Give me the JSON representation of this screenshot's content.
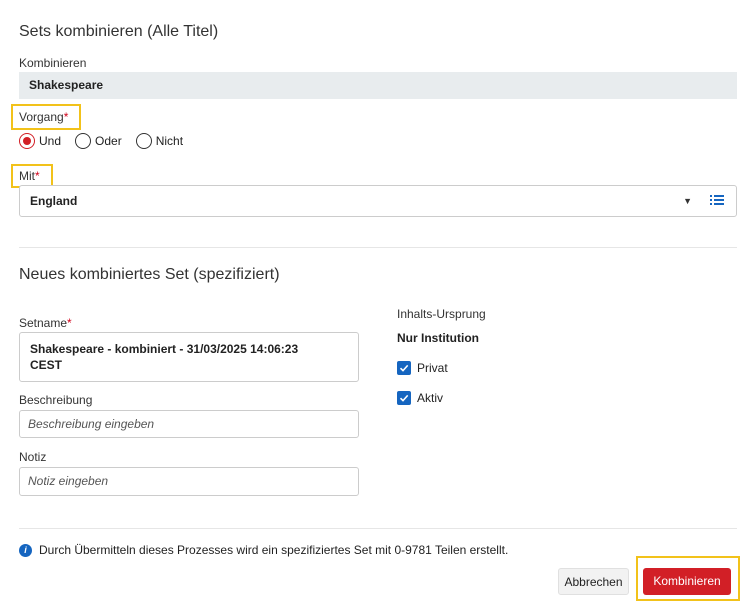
{
  "combine_section": {
    "title": "Sets kombinieren (Alle Titel)",
    "combine_label": "Kombinieren",
    "combine_value": "Shakespeare",
    "operation_label": "Vorgang",
    "required_mark": "*",
    "operations": [
      {
        "label": "Und",
        "checked": true
      },
      {
        "label": "Oder",
        "checked": false
      },
      {
        "label": "Nicht",
        "checked": false
      }
    ],
    "with_label": "Mit",
    "with_value": "England",
    "caret_glyph": "▼"
  },
  "new_set_section": {
    "title": "Neues kombiniertes Set (spezifiziert)",
    "setname_label": "Setname",
    "setname_value_line1": "Shakespeare - kombiniert - 31/03/2025 14:06:23",
    "setname_value_line2": "CEST",
    "description_label": "Beschreibung",
    "description_placeholder": "Beschreibung eingeben",
    "note_label": "Notiz",
    "note_placeholder": "Notiz eingeben",
    "content_origin_label": "Inhalts-Ursprung",
    "content_origin_value": "Nur Institution",
    "private_label": "Privat",
    "private_checked": true,
    "active_label": "Aktiv",
    "active_checked": true
  },
  "footer": {
    "info_text": "Durch Übermitteln dieses Prozesses wird ein spezifiziertes Set mit 0-9781 Teilen erstellt.",
    "cancel_label": "Abbrechen",
    "submit_label": "Kombinieren"
  },
  "colors": {
    "accent_red": "#d21f26",
    "highlight_yellow": "#f2c21a",
    "checkbox_blue": "#1565c0"
  }
}
